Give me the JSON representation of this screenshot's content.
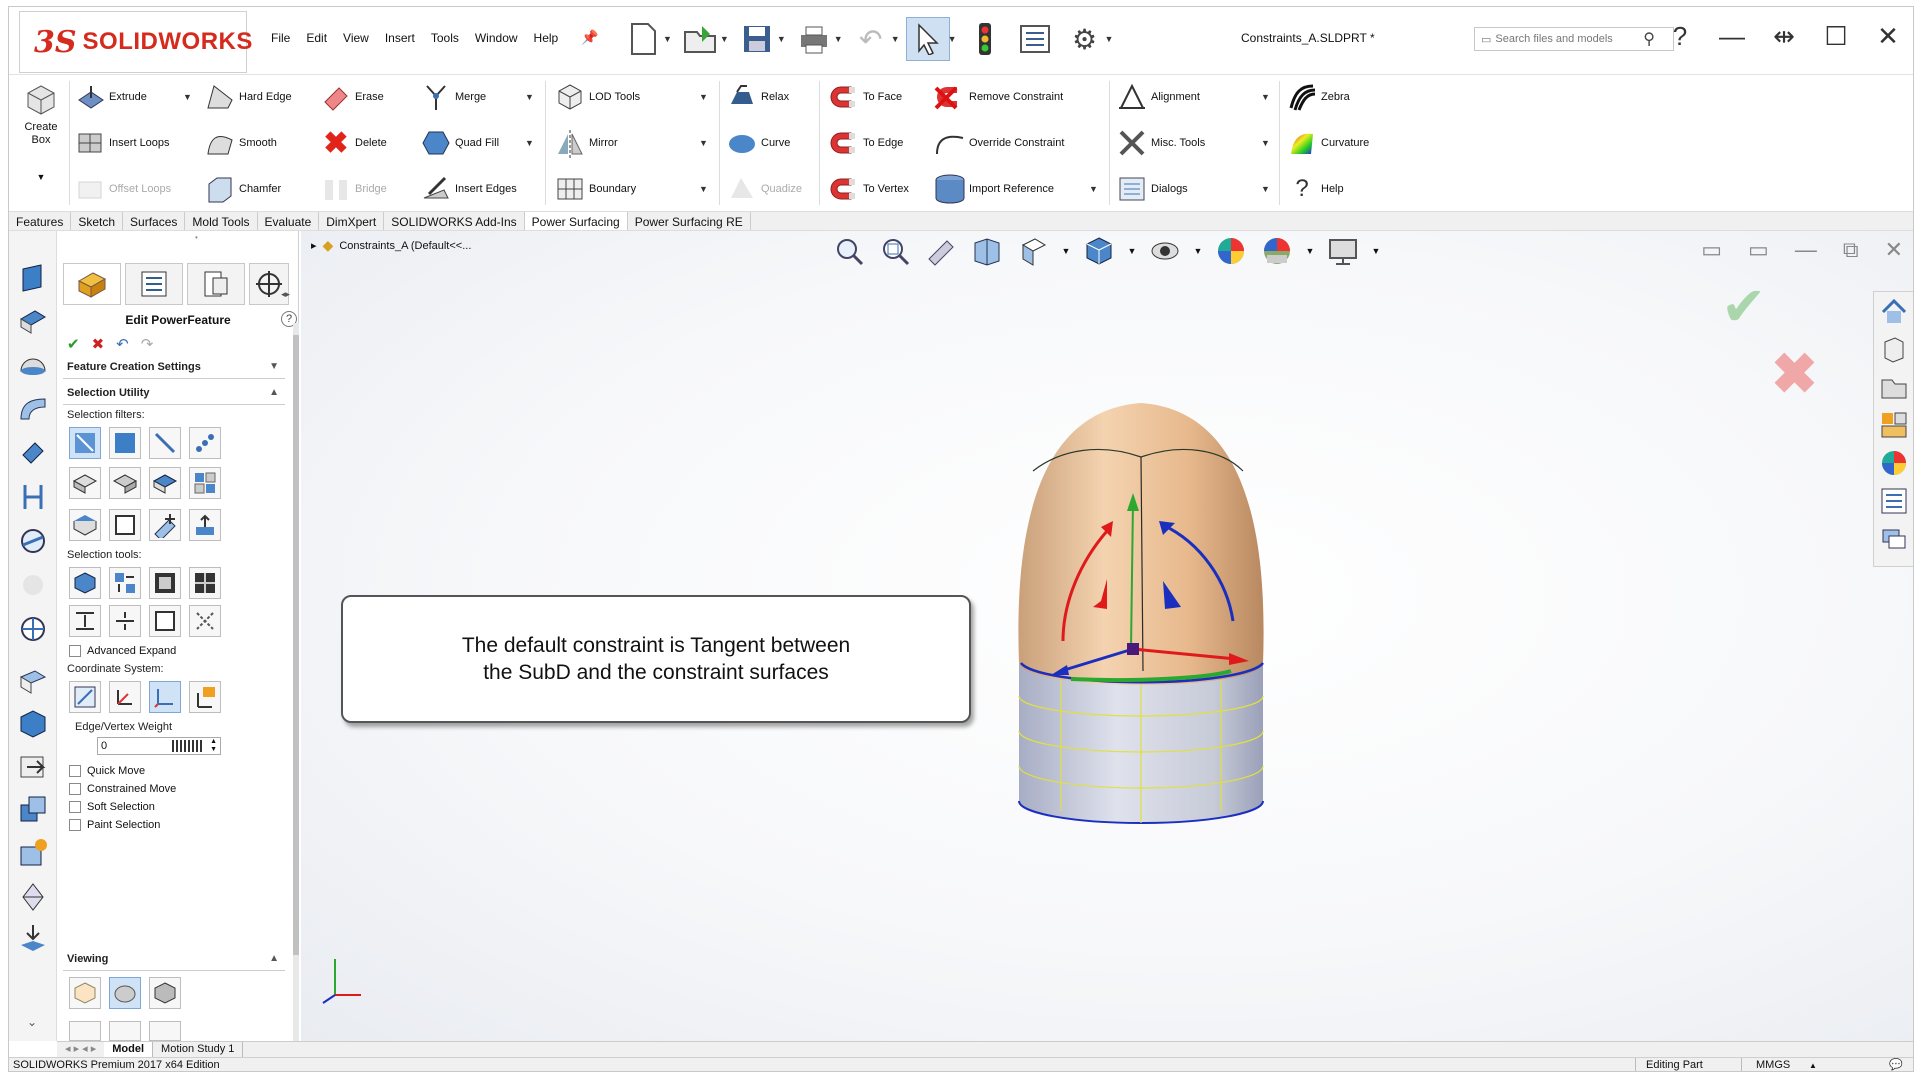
{
  "app": {
    "title": "Constraints_A.SLDPRT *",
    "brand_ds": "3S",
    "brand_name": "SOLIDWORKS"
  },
  "menu": [
    "File",
    "Edit",
    "View",
    "Insert",
    "Tools",
    "Window",
    "Help"
  ],
  "search": {
    "placeholder": "Search files and models"
  },
  "ribbon": {
    "create_box": "Create Box",
    "col1": [
      "Extrude",
      "Insert Loops",
      "Offset Loops"
    ],
    "col2": [
      "Hard Edge",
      "Smooth",
      "Chamfer"
    ],
    "col3": [
      "Erase",
      "Delete",
      "Bridge"
    ],
    "col4": [
      "Merge",
      "Quad Fill",
      "Insert Edges"
    ],
    "col5": [
      "LOD Tools",
      "Mirror",
      "Boundary"
    ],
    "col6": [
      "Relax",
      "Curve",
      "Quadize"
    ],
    "col7": [
      "To Face",
      "To Edge",
      "To Vertex"
    ],
    "col8": [
      "Remove Constraint",
      "Override Constraint",
      "Import Reference"
    ],
    "col9": [
      "Alignment",
      "Misc. Tools",
      "Dialogs"
    ],
    "col10": [
      "Zebra",
      "Curvature",
      "Help"
    ]
  },
  "tabs": [
    "Features",
    "Sketch",
    "Surfaces",
    "Mold Tools",
    "Evaluate",
    "DimXpert",
    "SOLIDWORKS Add-Ins",
    "Power Surfacing",
    "Power Surfacing RE"
  ],
  "active_tab": "Power Surfacing",
  "pm": {
    "title": "Edit PowerFeature",
    "help": "?",
    "feature_creation": "Feature Creation Settings",
    "selection_utility": "Selection Utility",
    "selection_filters": "Selection filters:",
    "selection_tools": "Selection tools:",
    "advanced_expand": "Advanced Expand",
    "coordinate_system": "Coordinate System:",
    "edge_vertex_weight": "Edge/Vertex Weight",
    "weight_value": "0",
    "quick_move": "Quick Move",
    "constrained_move": "Constrained Move",
    "soft_selection": "Soft Selection",
    "paint_selection": "Paint Selection",
    "viewing": "Viewing"
  },
  "tree": {
    "item": "Constraints_A  (Default<<..."
  },
  "callout": {
    "line1": "The default constraint is Tangent between",
    "line2": "the SubD and the constraint surfaces"
  },
  "bottom_tabs": [
    "Model",
    "Motion Study 1"
  ],
  "status": {
    "edition": "SOLIDWORKS Premium 2017 x64 Edition",
    "mode": "Editing Part",
    "units": "MMGS"
  },
  "colors": {
    "brand": "#d52b1e",
    "selection": "#cfe2f6",
    "model_top": "#e7b88c",
    "model_body": "#c7cbd8"
  }
}
